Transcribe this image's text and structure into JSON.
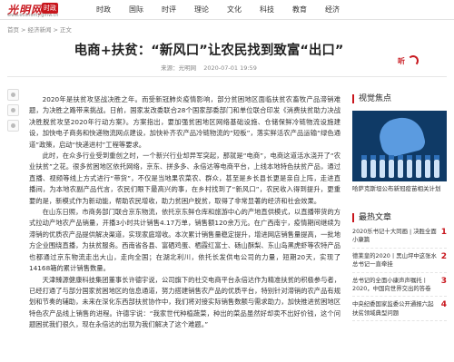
{
  "logo": {
    "name": "光明网",
    "badge": "时政",
    "url": "www.economy.gmw.cn"
  },
  "nav": [
    "时政",
    "国际",
    "时评",
    "理论",
    "文化",
    "科技",
    "教育",
    "经济"
  ],
  "breadcrumb": {
    "home": "首页",
    "section": "经济新闻",
    "current": "正文"
  },
  "article": {
    "title": "电商+扶贫：“新风口”让农民找到致富“出口”",
    "source": "来源：光明网",
    "date": "2020-07-01 19:59",
    "listen": "听",
    "paragraphs": [
      "2020年是扶贫攻坚战决胜之年。而受新冠肺炎疫情影响，部分贫困地区面临扶贫农畜牧产品滞销难题，为决胜之路带来挑战。日前，国家发改委联合28个国家部委部门和单位联合印发《消费扶贫助力决战决胜脱贫攻坚2020年行动方案》。方案指出，要加强贫困地区网络基础设施、仓储保鲜冷链物流设施建设，加快电子商务和快递物流网点建设，加快补齐农产品冷链物流的“短板”，落实鲜活农产品运输“绿色通道”政策，启动“快递进村”工程等要求。",
      "此时，在众多行业受到重创之时，一个新兴行业却异军突起，那就是“电商”，电商这道活水浇开了“农业扶贫”之花。很多贫困地区依托网络，京东、拼多多、永倍达等电商平台，上线本地特色扶贫产品，通过直播、视频等线上方式进行“带货”，不仅是当地果农菜农、群众，甚至是乡长县长更是亲自上阵，走进直播间，为本地农副产品代言，农民们眼下最高兴的事，在乡村找到了“新风口”，农民收入得到提升，更重要的是，新模式作为新动能，帮助农民增收，助力贫困户脱贫，取得了非常显著的经济和社会效果。",
      "在山东日照，市商务部门联合京东物流，依托京东鲜仓库和旅游中心的产地直供模式，以直播带货的方式拉动产地农产品销量，开播3小时共计销售4.17万单，销售额120余万元。在广西南宁，疫情期间继续为滞销的优质农产品提供解决渠道，实现家庭增收。本次累计销售量稳定提升，增进网店销售量提高，一批地方企业围绕直播，为扶贫服务。西南省各县、富硒鸡蛋、栖霞红富士、砀山酥梨、东山岛黑虎虾等农特产品也都通过京东物流走出大山，走向全国；在湖北利川，依托长发供电公司的力量，短期20天，实现了14168箱的累计销售数量。",
      "天津臻源健康科技集团董事长许德宇说，公司旗下的社交电商平台永倍达作为精准扶贫的积极参与者，已经打通了与部分国家贫困地区的信息通道，努力搭建销售农产品的优质平台，特别针对滞销的农产品有规划和节奏的辅助，未来在深化东西部扶贫协作中，我们将对接实际销售数额与需求助力，加快推进贫困地区特色农产品线上销售的进程。许德宇说：“我家世代种植蔬菜，种出的菜品虽然好却卖不出好价钱，这个问题困扰我们很久，现在永倍达的出现为我们解决了这个难题。”"
    ]
  },
  "aside": {
    "focus_heading": "视觉焦点",
    "focus_caption": "哈萨克斯坦公布新冠疫苗相关计划",
    "news_heading": "最热文章",
    "news": [
      {
        "title": "2020乐书记十大同画 | 决胜全面小康篇",
        "num": "1"
      },
      {
        "title": "德莱皇的2020丨黑山坪中这张水 总书记一直牵挂",
        "num": "2"
      },
      {
        "title": "总书记的全面小康声声嘱托丨2020，中国向世界交出的答卷",
        "num": "3"
      },
      {
        "title": "中央纪委国家监委公开通报六起扶贫领域典型问题",
        "num": "4"
      }
    ]
  },
  "colors": {
    "brand_red": "#c8161d",
    "text": "#333333",
    "muted": "#888888"
  }
}
